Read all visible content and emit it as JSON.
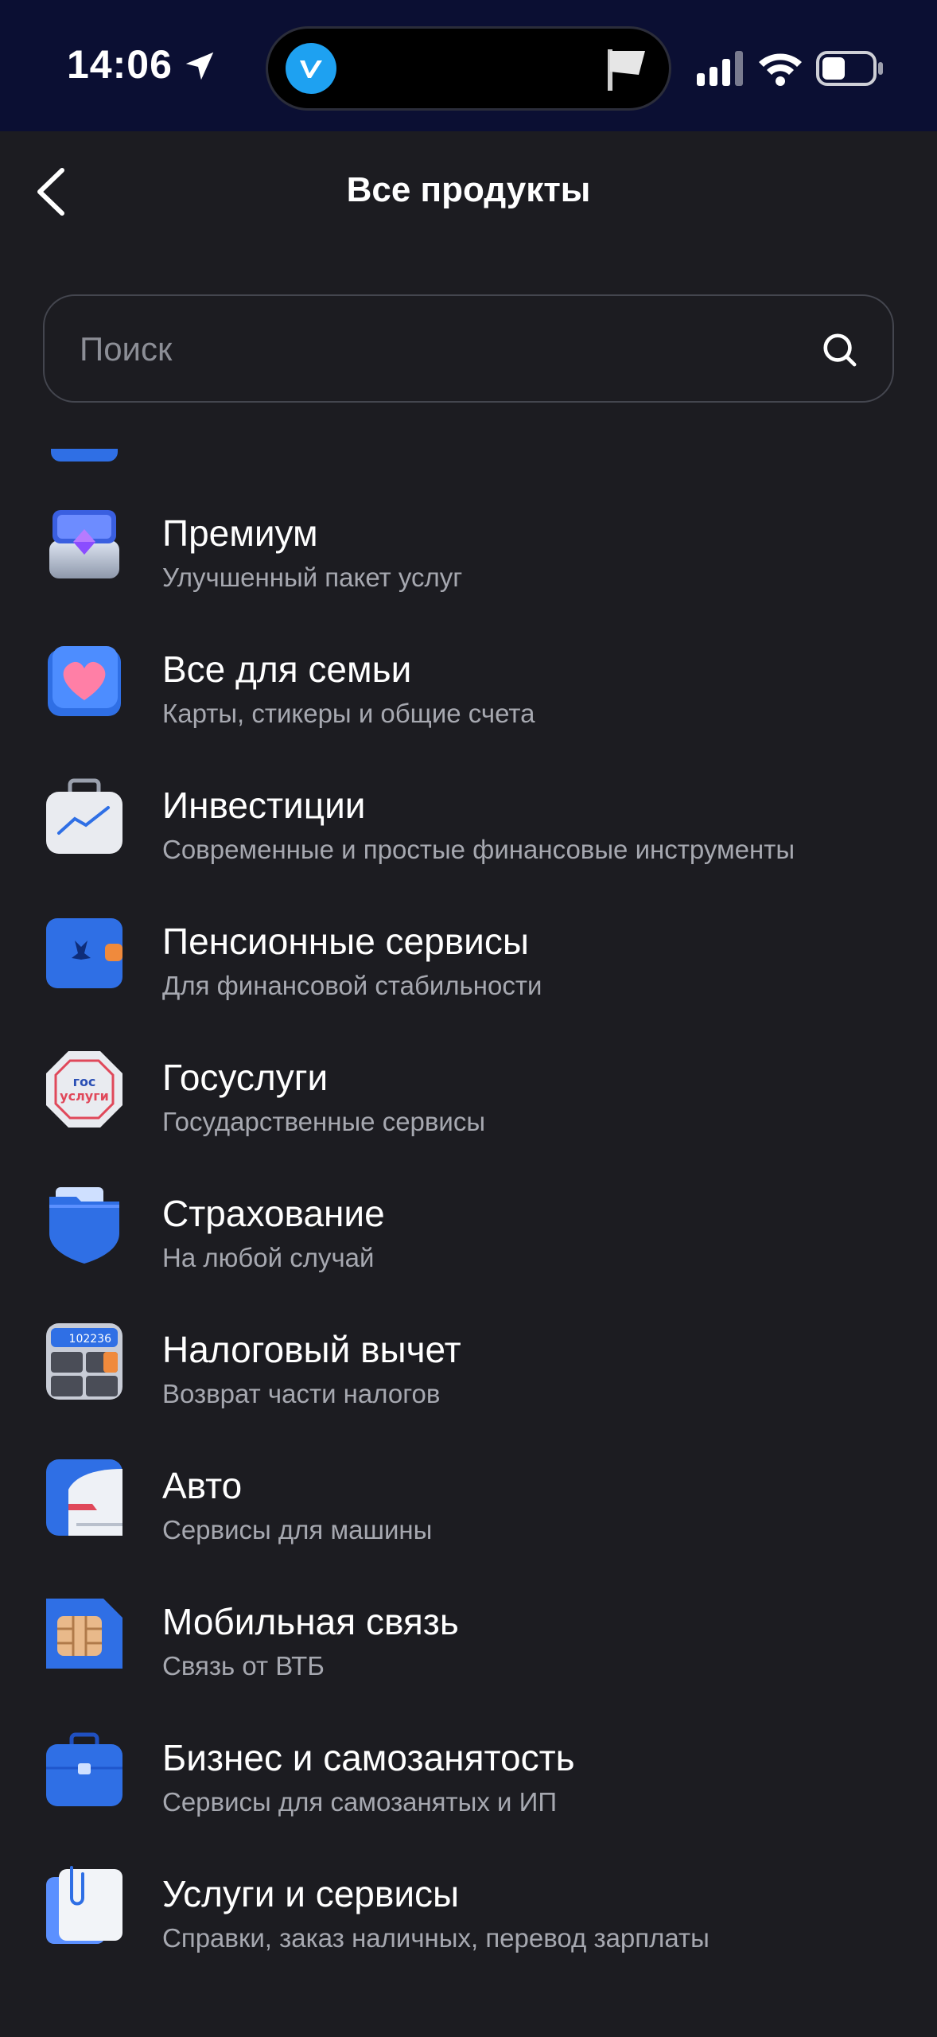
{
  "status_bar": {
    "time": "14:06",
    "icons": [
      "location-arrow-icon",
      "vk-icon",
      "flag-icon",
      "cellular-signal-icon",
      "wifi-icon",
      "battery-icon"
    ]
  },
  "header": {
    "title": "Все продукты",
    "back_icon": "chevron-left-icon"
  },
  "search": {
    "placeholder": "Поиск",
    "value": "",
    "icon": "search-icon"
  },
  "colors": {
    "background": "#1c1c21",
    "status_bar": "#0b0f33",
    "secondary_text": "#a6a8b0",
    "accent": "#2f6fe5"
  },
  "products": [
    {
      "name": "Премиум",
      "description": "Улучшенный пакет услуг",
      "icon": "diamond-box-icon"
    },
    {
      "name": "Все для семьи",
      "description": "Карты, стикеры и общие счета",
      "icon": "heart-card-icon"
    },
    {
      "name": "Инвестиции",
      "description": "Современные и простые финансовые инструменты",
      "icon": "briefcase-chart-icon"
    },
    {
      "name": "Пенсионные сервисы",
      "description": "Для финансовой стабильности",
      "icon": "pension-wallet-icon"
    },
    {
      "name": "Госуслуги",
      "description": "Государственные сервисы",
      "icon": "gosuslugi-icon",
      "icon_text": "гос услуги"
    },
    {
      "name": "Страхование",
      "description": "На любой случай",
      "icon": "shield-folder-icon"
    },
    {
      "name": "Налоговый вычет",
      "description": "Возврат части налогов",
      "icon": "calculator-icon",
      "icon_text": "102236"
    },
    {
      "name": "Авто",
      "description": "Сервисы для машины",
      "icon": "car-icon"
    },
    {
      "name": "Мобильная связь",
      "description": "Связь от ВТБ",
      "icon": "sim-card-icon"
    },
    {
      "name": "Бизнес и самозанятость",
      "description": "Сервисы для самозанятых и ИП",
      "icon": "business-bag-icon"
    },
    {
      "name": "Услуги и сервисы",
      "description": "Справки, заказ наличных, перевод зарплаты",
      "icon": "documents-clip-icon"
    }
  ]
}
